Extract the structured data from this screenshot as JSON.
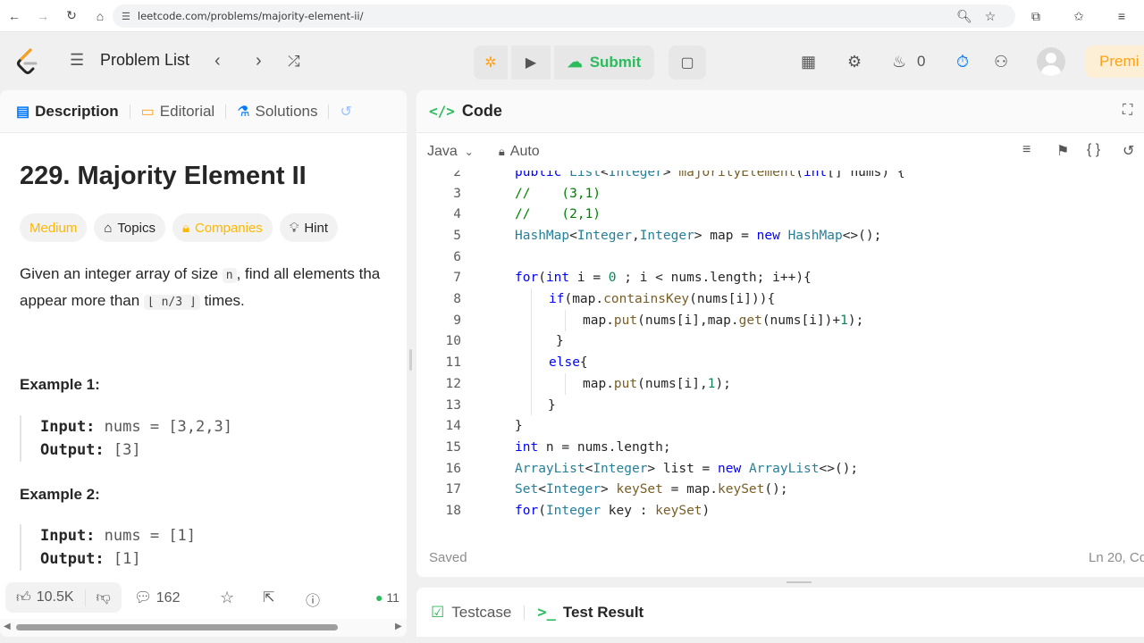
{
  "browser": {
    "url": "leetcode.com/problems/majority-element-ii/"
  },
  "nav": {
    "problem_list": "Problem List",
    "submit": "Submit",
    "streak_count": "0",
    "premium": "Premi"
  },
  "left_tabs": {
    "description": "Description",
    "editorial": "Editorial",
    "solutions": "Solutions"
  },
  "problem": {
    "title": "229. Majority Element II",
    "difficulty": "Medium",
    "topics": "Topics",
    "companies": "Companies",
    "hint": "Hint",
    "desc_line1_a": "Given an integer array of size ",
    "desc_code_n": "n",
    "desc_line1_b": ", find all elements tha",
    "desc_line2_a": "appear more than ",
    "desc_code_floor": "⌊ n/3 ⌋",
    "desc_line2_b": " times.",
    "example1_title": "Example 1:",
    "example1_input_label": "Input:",
    "example1_input_value": "nums = [3,2,3]",
    "example1_output_label": "Output:",
    "example1_output_value": "[3]",
    "example2_title": "Example 2:",
    "example2_input_label": "Input:",
    "example2_input_value": "nums = [1]",
    "example2_output_label": "Output:",
    "example2_output_value": "[1]"
  },
  "left_bottom": {
    "likes": "10.5K",
    "comments": "162",
    "online": "11"
  },
  "code_panel": {
    "header": "Code",
    "language": "Java",
    "mode": "Auto",
    "saved": "Saved",
    "cursor_pos": "Ln 20, Co"
  },
  "code_lines": [
    {
      "n": "2",
      "text": "public List<Integer> majorityElement(int[] nums) {"
    },
    {
      "n": "3",
      "text": "//    (3,1)"
    },
    {
      "n": "4",
      "text": "//    (2,1)"
    },
    {
      "n": "5",
      "text": "HashMap<Integer,Integer> map = new HashMap<>();"
    },
    {
      "n": "6",
      "text": ""
    },
    {
      "n": "7",
      "text": "for(int i = 0 ; i < nums.length; i++){"
    },
    {
      "n": "8",
      "text": "if(map.containsKey(nums[i])){"
    },
    {
      "n": "9",
      "text": "map.put(nums[i],map.get(nums[i])+1);"
    },
    {
      "n": "10",
      "text": "}"
    },
    {
      "n": "11",
      "text": "else{"
    },
    {
      "n": "12",
      "text": "map.put(nums[i],1);"
    },
    {
      "n": "13",
      "text": "}"
    },
    {
      "n": "14",
      "text": "}"
    },
    {
      "n": "15",
      "text": "int n = nums.length;"
    },
    {
      "n": "16",
      "text": "ArrayList<Integer> list = new ArrayList<>();"
    },
    {
      "n": "17",
      "text": "Set<Integer> keySet = map.keySet();"
    },
    {
      "n": "18",
      "text": "for(Integer key : keySet)"
    }
  ],
  "result_tabs": {
    "testcase": "Testcase",
    "test_result": "Test Result"
  },
  "colors": {
    "accent_orange": "#ffa116",
    "submit_green": "#2cbb5d",
    "medium_yellow": "#ffb800",
    "link_blue": "#007aff"
  }
}
